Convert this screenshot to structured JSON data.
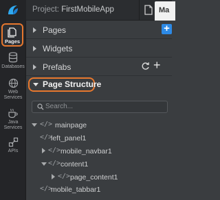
{
  "header": {
    "project_prefix": "Project:",
    "project_name": "FirstMobileApp",
    "tab_label": "Ma"
  },
  "rail": {
    "pages": "Pages",
    "databases": "Databases",
    "web_services_1": "Web",
    "web_services_2": "Services",
    "java_services_1": "Java",
    "java_services_2": "Services",
    "apis": "APIs"
  },
  "panel": {
    "pages": "Pages",
    "widgets": "Widgets",
    "prefabs": "Prefabs",
    "page_structure": "Page Structure",
    "search_placeholder": "Search...",
    "plus": "+"
  },
  "tree": [
    {
      "label": "mainpage",
      "code": "</>"
    },
    {
      "label": "left_panel1",
      "code": "</>"
    },
    {
      "label": "mobile_navbar1",
      "code": "</>"
    },
    {
      "label": "content1",
      "code": "</>"
    },
    {
      "label": "page_content1",
      "code": "</>"
    },
    {
      "label": "mobile_tabbar1",
      "code": "</>"
    }
  ],
  "colors": {
    "accent_orange": "#e8782e",
    "accent_blue": "#2d8ae6"
  }
}
